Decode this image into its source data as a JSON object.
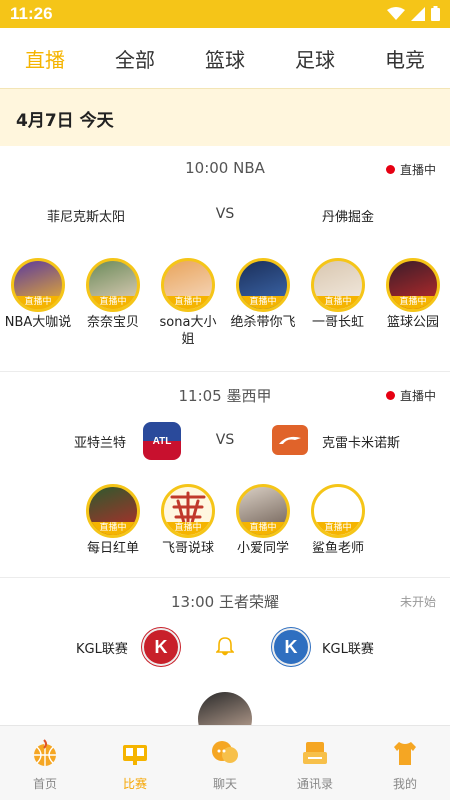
{
  "status_bar": {
    "time": "11:26"
  },
  "tabs": [
    {
      "label": "直播",
      "active": true
    },
    {
      "label": "全部",
      "active": false
    },
    {
      "label": "篮球",
      "active": false
    },
    {
      "label": "足球",
      "active": false
    },
    {
      "label": "电竞",
      "active": false
    }
  ],
  "date_header": "4月7日  今天",
  "matches": [
    {
      "title": "10:00  NBA",
      "status": "直播中",
      "home": "菲尼克斯太阳",
      "vs": "VS",
      "away": "丹佛掘金",
      "anchors": [
        {
          "name": "NBA大咖说",
          "badge": "直播中"
        },
        {
          "name": "奈奈宝贝",
          "badge": "直播中"
        },
        {
          "name": "sona大小姐",
          "badge": "直播中"
        },
        {
          "name": "绝杀带你飞",
          "badge": "直播中"
        },
        {
          "name": "一哥长虹",
          "badge": "直播中"
        },
        {
          "name": "篮球公园",
          "badge": "直播中"
        }
      ]
    },
    {
      "title": "11:05  墨西甲",
      "status": "直播中",
      "home": "亚特兰特",
      "vs": "VS",
      "away": "克雷卡米诺斯",
      "anchors": [
        {
          "name": "每日红单",
          "badge": "直播中"
        },
        {
          "name": "飞哥说球",
          "badge": "直播中"
        },
        {
          "name": "小爱同学",
          "badge": "直播中"
        },
        {
          "name": "鲨鱼老师",
          "badge": "直播中"
        }
      ]
    },
    {
      "title": "13:00  王者荣耀",
      "status": "未开始",
      "home": "KGL联赛",
      "home_logo": "K",
      "away": "KGL联赛",
      "away_logo": "K"
    }
  ],
  "bottom_nav": [
    {
      "label": "首页",
      "icon": "basketball-icon",
      "active": false
    },
    {
      "label": "比赛",
      "icon": "scoreboard-icon",
      "active": true
    },
    {
      "label": "聊天",
      "icon": "chat-bubble-icon",
      "active": false
    },
    {
      "label": "通讯录",
      "icon": "contacts-icon",
      "active": false
    },
    {
      "label": "我的",
      "icon": "shirt-icon",
      "active": false
    }
  ],
  "colors": {
    "accent": "#f5c518",
    "live_dot": "#e60012",
    "badge": "#f5b400"
  }
}
